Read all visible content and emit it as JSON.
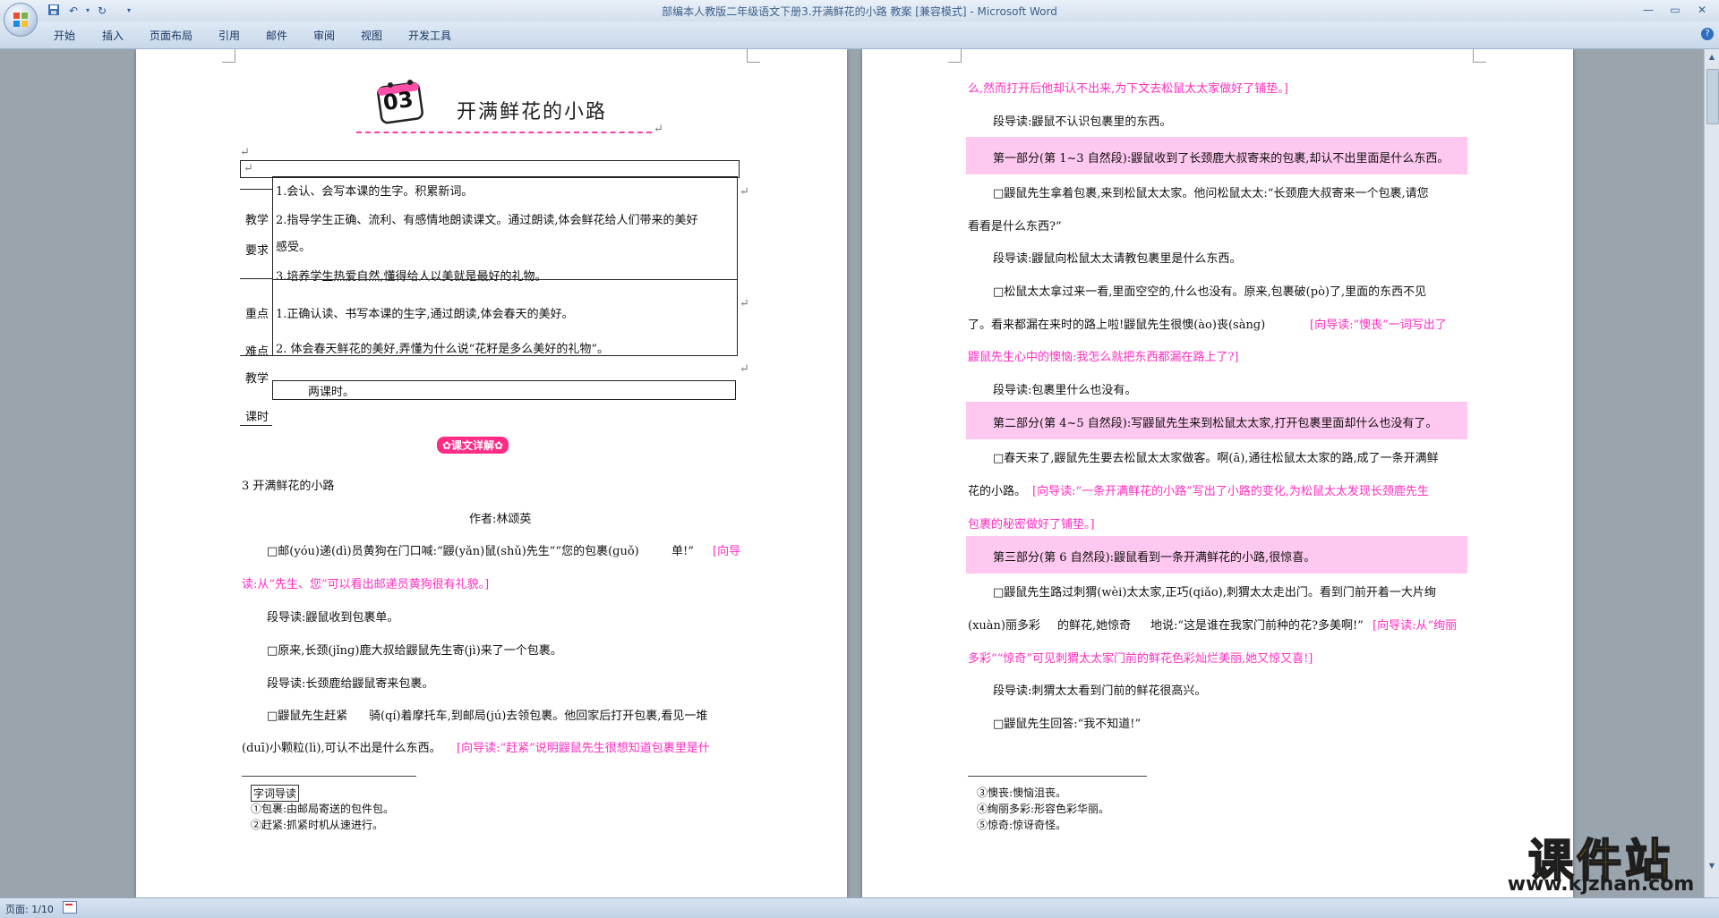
{
  "window": {
    "title": "部编本人教版二年级语文下册3.开满鲜花的小路 教案 [兼容模式] - Microsoft Word"
  },
  "ribbon": {
    "tabs": [
      "开始",
      "插入",
      "页面布局",
      "引用",
      "邮件",
      "审阅",
      "视图",
      "开发工具"
    ]
  },
  "status": {
    "page": "页面: 1/10"
  },
  "page1": {
    "lesson_number": "03",
    "lesson_title": "开满鲜花的小路",
    "table": {
      "req_label_1": "教学",
      "req_label_2": "要求",
      "req_1": "1.会认、会写本课的生字。积累新词。",
      "req_2a": "2.指导学生正确、流利、有感情地朗读课文。通过朗读,体会鲜花给人们带来的美好",
      "req_2b": "感受。",
      "req_3": "3.培养学生热爱自然,懂得给人以美就是最好的礼物。",
      "key_label_1": "重点",
      "key_label_2": "难点",
      "key_1": "1.正确认读、书写本课的生字,通过朗读,体会春天的美好。",
      "key_2": "2. 体会春天鲜花的美好,弄懂为什么说“花籽是多么美好的礼物”。",
      "time_label_1": "教学",
      "time_label_2": "课时",
      "time_value": "两课时。"
    },
    "section_badge": "✿课文详解✿",
    "text_heading": "3  开满鲜花的小路",
    "author": "作者:林颂英",
    "para1_a": "□邮(yóu)递(dì)员黄狗在门口喊:“鼹(yǎn)鼠(shǔ)先生”“您的包裹(ɡuǒ)",
    "para1_b": "单!”",
    "para1_c": "[向导",
    "para1_d": "读:从“先生、您”可以看出邮递员黄狗很有礼貌。]",
    "guide1": "段导读:鼹鼠收到包裹单。",
    "para2": "□原来,长颈(jǐnɡ)鹿大叔给鼹鼠先生寄(jì)来了一个包裹。",
    "guide2": "段导读:长颈鹿给鼹鼠寄来包裹。",
    "para3_a": "□鼹鼠先生赶紧",
    "para3_b": "骑(qí)着摩托车,到邮局(jú)去领包裹。他回家后打开包裹,看见一堆",
    "para3_c": "(duī)小颗粒(lì),可认不出是什么东西。",
    "para3_d": "[向导读:“赶紧”说明鼹鼠先生很想知道包裹里是什",
    "footnote_1": "字词导读",
    "footnote_2": "①包裹:由邮局寄送的包件包。",
    "footnote_3": "②赶紧:抓紧时机从速进行。"
  },
  "page2": {
    "line1": "么,然而打开后他却认不出来,为下文去松鼠太太家做好了铺垫。]",
    "guide_a": "段导读:鼹鼠不认识包裹里的东西。",
    "part1": "第一部分(第 1~3 自然段):鼹鼠收到了长颈鹿大叔寄来的包裹,却认不出里面是什么东西。",
    "para4_a": "□鼹鼠先生拿着包裹,来到松鼠太太家。他问松鼠太太:“长颈鹿大叔寄来一个包裹,请您",
    "para4_b": "看看是什么东西?”",
    "guide_b": "段导读:鼹鼠向松鼠太太请教包裹里是什么东西。",
    "para5_a": "□松鼠太太拿过来一看,里面空空的,什么也没有。原来,包裹破(pò)了,里面的东西不见",
    "para5_b": "了。看来都漏在来时的路上啦!鼹鼠先生很懊(ào)丧(sànɡ)",
    "para5_c": "[向导读:“懊丧”一词写出了",
    "para5_d": "鼹鼠先生心中的懊恼:我怎么就把东西都漏在路上了?]",
    "guide_c": "段导读:包裹里什么也没有。",
    "part2": "第二部分(第 4~5 自然段):写鼹鼠先生来到松鼠太太家,打开包裹里面却什么也没有了。",
    "para6_a": "□春天来了,鼹鼠先生要去松鼠太太家做客。啊(ā),通往松鼠太太家的路,成了一条开满鲜",
    "para6_b": "花的小路。",
    "para6_c": "[向导读:“一条开满鲜花的小路”写出了小路的变化,为松鼠太太发现长颈鹿先生",
    "para6_d": "包裹的秘密做好了铺垫。]",
    "part3": "第三部分(第 6 自然段):鼹鼠看到一条开满鲜花的小路,很惊喜。",
    "para7_a": "□鼹鼠先生路过刺猬(wèi)太太家,正巧(qiǎo),刺猬太太走出门。看到门前开着一大片绚",
    "para7_b": "(xuàn)丽多彩",
    "para7_c": "的鲜花,她惊奇",
    "para7_d": "地说:“这是谁在我家门前种的花?多美啊!”",
    "para7_e": "[向导读:从“绚丽",
    "para7_f": "多彩”“惊奇”可见刺猬太太家门前的鲜花色彩灿烂美丽,她又惊又喜!]",
    "guide_d": "段导读:刺猬太太看到门前的鲜花很高兴。",
    "para8": "□鼹鼠先生回答:“我不知道!”",
    "footnote_4": "③懊丧:懊恼沮丧。",
    "footnote_5": "④绚丽多彩:形容色彩华丽。",
    "footnote_6": "⑤惊奇:惊讶奇怪。"
  },
  "watermark": {
    "text": "课件站",
    "url": "www.kjzhan.com"
  },
  "colors": {
    "pink_text": "#ff2cc2",
    "highlight": "#ffc8f0",
    "watermark": "#ffd200"
  }
}
